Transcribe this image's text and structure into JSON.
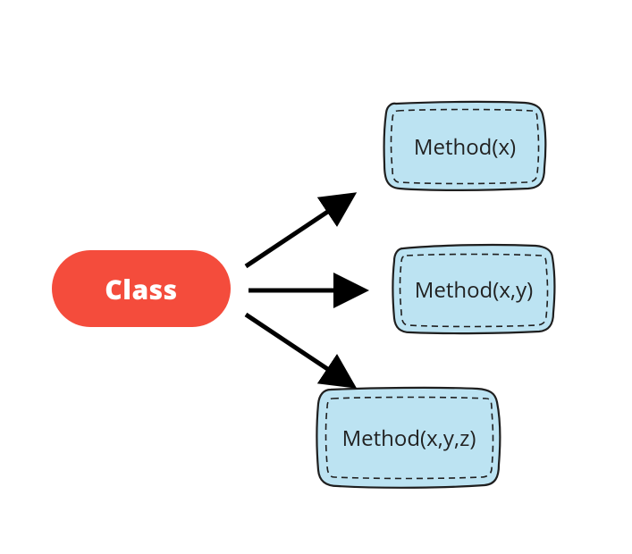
{
  "diagram": {
    "class_label": "Class",
    "methods": [
      {
        "signature": "Method(x)"
      },
      {
        "signature": "Method(x,y)"
      },
      {
        "signature": "Method(x,y,z)"
      }
    ],
    "colors": {
      "class_fill": "#f44c3c",
      "method_fill": "#bce3f2",
      "stroke": "#1f1f1f"
    }
  }
}
